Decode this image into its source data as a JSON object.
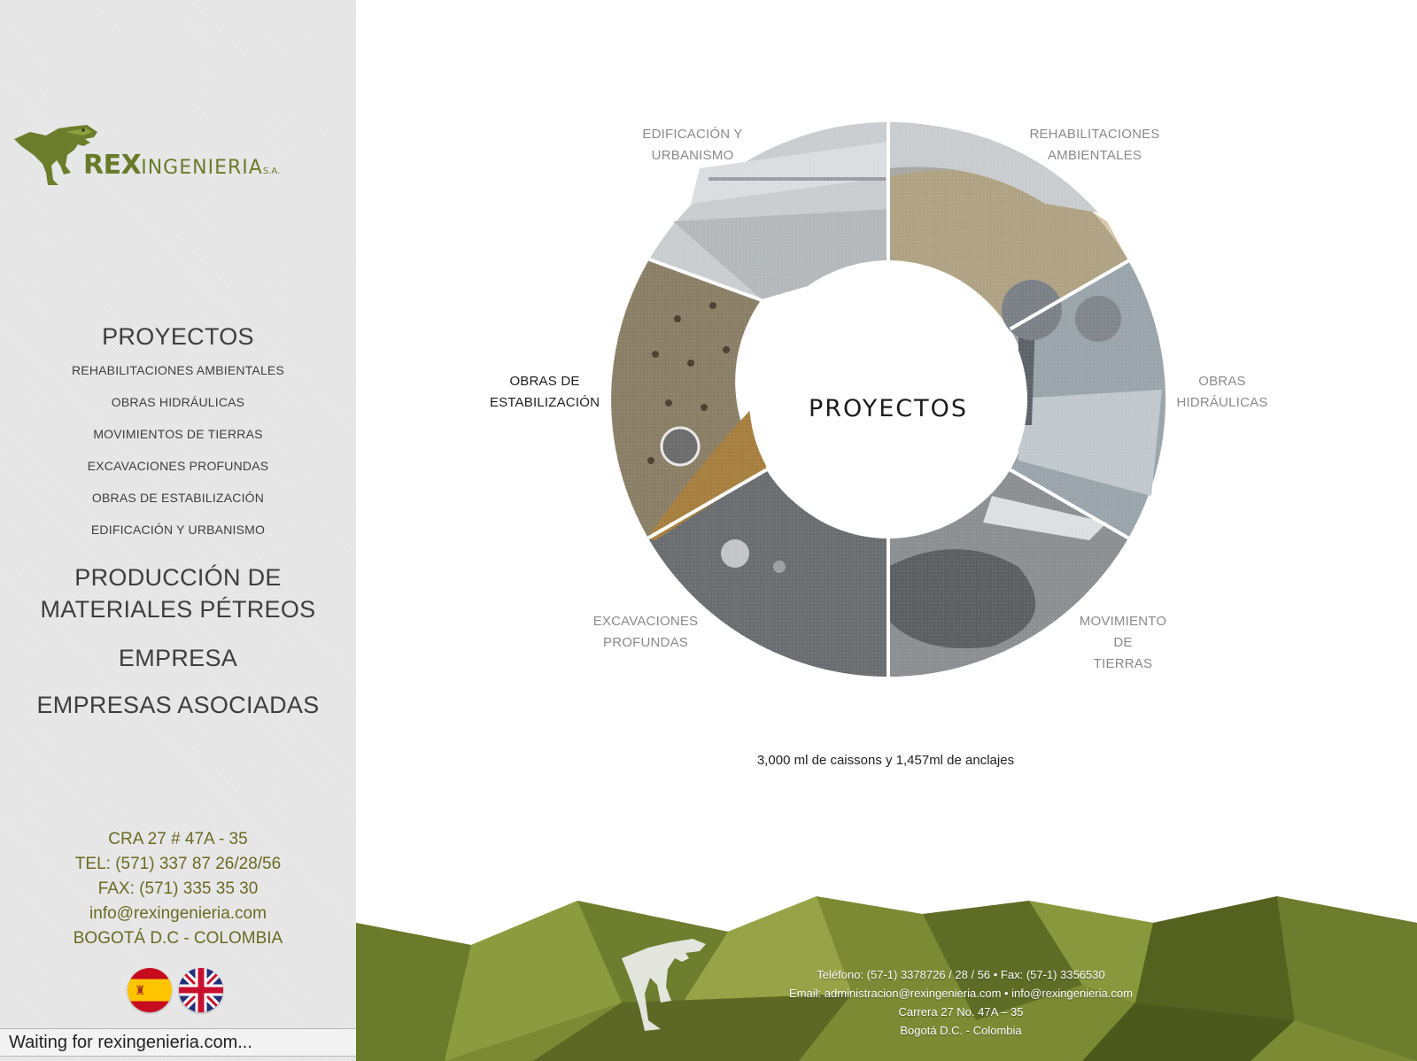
{
  "logo": {
    "rex": "REX",
    "ingenieria": "INGENIERIA",
    "sa": "S.A."
  },
  "nav": {
    "proyectos": "PROYECTOS",
    "sub_items": [
      "REHABILITACIONES AMBIENTALES",
      "OBRAS HIDRÁULICAS",
      "MOVIMIENTOS DE TIERRAS",
      "EXCAVACIONES PROFUNDAS",
      "OBRAS DE ESTABILIZACIÓN",
      "EDIFICACIÓN Y URBANISMO"
    ],
    "produccion_line1": "PRODUCCIÓN DE",
    "produccion_line2": "MATERIALES PÉTREOS",
    "empresa": "EMPRESA",
    "empresas_asociadas": "EMPRESAS ASOCIADAS"
  },
  "contact": {
    "address": "CRA 27 # 47A - 35",
    "tel": "TEL: (571) 337 87 26/28/56",
    "fax": "FAX: (571) 335 35 30",
    "email": "info@rexingenieria.com",
    "city": "BOGOTÁ D.C - COLOMBIA"
  },
  "languages": [
    {
      "name": "Español",
      "icon": "spain-flag-icon"
    },
    {
      "name": "English",
      "icon": "uk-flag-icon"
    }
  ],
  "status_bar": "Waiting for rexingenieria.com...",
  "wheel": {
    "center_title": "PROYECTOS",
    "segments": {
      "edificacion": {
        "line1": "EDIFICACIÓN Y",
        "line2": "URBANISMO"
      },
      "rehabilitaciones": {
        "line1": "REHABILITACIONES",
        "line2": "AMBIENTALES"
      },
      "hidraulicas": {
        "line1": "OBRAS",
        "line2": "HIDRÁULICAS"
      },
      "movimiento": {
        "line1": "MOVIMIENTO",
        "line2": "DE",
        "line3": "TIERRAS"
      },
      "excavaciones": {
        "line1": "EXCAVACIONES",
        "line2": "PROFUNDAS"
      },
      "estabilizacion": {
        "line1": "OBRAS DE",
        "line2": "ESTABILIZACIÓN"
      }
    },
    "active_segment": "estabilizacion"
  },
  "caption": "3,000 ml de caissons y 1,457ml de anclajes",
  "footer": {
    "line1": "Teléfono: (57-1) 3378726 / 28 / 56 • Fax: (57-1) 3356530",
    "line2": "Email: administracion@rexingenieria.com • info@rexingenieria.com",
    "line3": "Carrera 27 No. 47A – 35",
    "line4": "Bogotá D.C. - Colombia"
  },
  "colors": {
    "sidebar_bg": "#e4e4e4",
    "brand_green": "#6b7a2a",
    "contact_olive": "#6a6a24",
    "footer_green": "#7c8a34"
  }
}
